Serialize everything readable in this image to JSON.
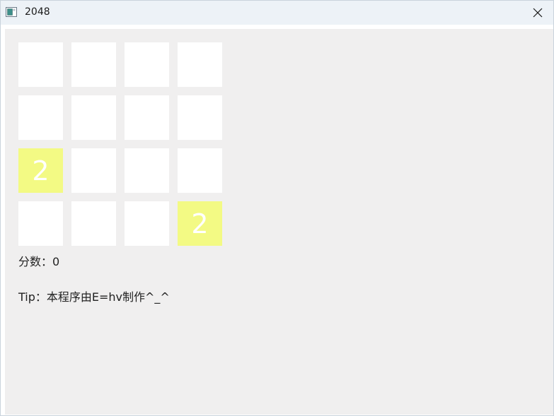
{
  "window": {
    "title": "2048",
    "close_icon": "close-icon"
  },
  "game": {
    "tile_color_2": "#f3fa84",
    "empty_tile_color": "#ffffff",
    "board": [
      [
        "",
        "",
        "",
        ""
      ],
      [
        "",
        "",
        "",
        ""
      ],
      [
        "2",
        "",
        "",
        ""
      ],
      [
        "",
        "",
        "",
        "2"
      ]
    ],
    "score_label": "分数：",
    "score_value": "0",
    "tip_text": "Tip：本程序由E=hv制作^_^"
  }
}
